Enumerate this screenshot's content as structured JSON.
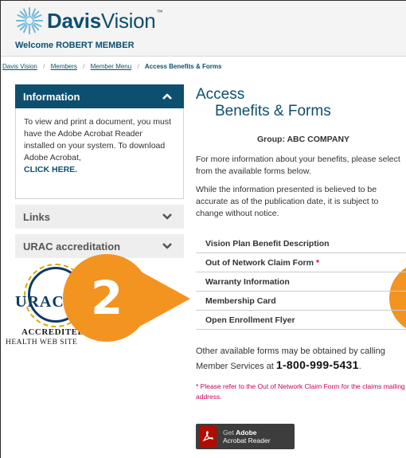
{
  "header": {
    "brand_bold": "Davis",
    "brand_light": "Vision",
    "brand_tm": "™",
    "welcome": "Welcome ROBERT MEMBER"
  },
  "breadcrumb": {
    "items": [
      "Davis Vision",
      "Members",
      "Member Menu"
    ],
    "separator": "/",
    "current": "Access Benefits & Forms"
  },
  "sidebar": {
    "information": {
      "title": "Information",
      "body": "To view and print a document, you must have the Adobe Acrobat Reader installed on your system. To download Adobe Acrobat,",
      "link": "CLICK HERE."
    },
    "links_title": "Links",
    "urac_title": "URAC accreditation",
    "seal": {
      "main": "URAC",
      "accredited": "ACCREDITED",
      "subtitle": "HEALTH WEB SITE"
    }
  },
  "callout": {
    "number": "2"
  },
  "main": {
    "title_line1": "Access",
    "title_line2": "Benefits & Forms",
    "group": "Group: ABC COMPANY",
    "para1": "For more information about your benefits, please select from the available forms below.",
    "para2": "While the information presented is believed to be accurate as of the publication date, it is subject to change without notice.",
    "forms": [
      {
        "label": "Vision Plan Benefit Description",
        "star": ""
      },
      {
        "label": "Out of Network Claim Form",
        "star": "*"
      },
      {
        "label": "Warranty Information",
        "star": ""
      },
      {
        "label": "Membership Card",
        "star": ""
      },
      {
        "label": "Open Enrollment Flyer",
        "star": ""
      }
    ],
    "other_text": "Other available forms may be obtained by calling Member Services at",
    "phone": "1-800-999-5431",
    "phone_suffix": ".",
    "note": "* Please refer to the Out of Network Claim Form for the claims mailing address."
  },
  "adobe": {
    "get": "Get",
    "brand": "Adobe",
    "product": "Acrobat Reader"
  },
  "colors": {
    "brand_navy": "#0d4f6e",
    "callout_orange": "#f39320",
    "note_pink": "#c8005a"
  }
}
